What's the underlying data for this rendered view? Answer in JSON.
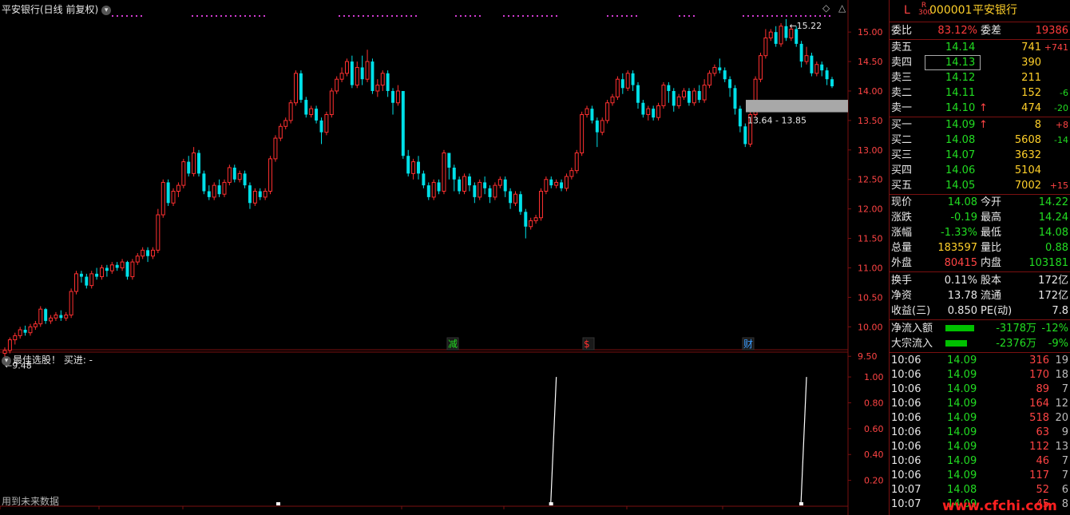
{
  "main_chart": {
    "title": "平安银行(日线 前复权)",
    "high_label": "15.22",
    "low_label": "9.48",
    "range_label": "13.64 - 13.85",
    "y_ticks": [
      "15.00",
      "14.50",
      "14.00",
      "13.50",
      "13.00",
      "12.50",
      "12.00",
      "11.50",
      "11.00",
      "10.50",
      "10.00",
      "9.50"
    ],
    "markers": [
      {
        "text": "减",
        "color": "#22dd22"
      },
      {
        "text": "$",
        "color": "#ff3030"
      },
      {
        "text": "财",
        "color": "#3a9cff"
      }
    ],
    "colors": {
      "up": "#ff3030",
      "down": "#00e0e8",
      "dots": "#d23cd2",
      "grid_frame": "#7a1010"
    }
  },
  "sub_chart": {
    "title": "最佳选股！ 买进: -",
    "y_ticks": [
      "1.00",
      "0.80",
      "0.60",
      "0.40",
      "0.20"
    ],
    "note": "用到未来数据"
  },
  "chart_data": {
    "type": "candlestick",
    "title": "平安银行(日线 前复权)",
    "ylim": [
      9.3,
      15.3
    ],
    "annotations": {
      "high": 15.22,
      "low": 9.48,
      "range": "13.64 - 13.85"
    },
    "candles": [
      [
        9.55,
        9.6,
        9.48,
        9.65
      ],
      [
        9.6,
        9.78,
        9.55,
        9.82
      ],
      [
        9.78,
        9.85,
        9.7,
        9.9
      ],
      [
        9.85,
        9.95,
        9.8,
        10.0
      ],
      [
        9.95,
        9.9,
        9.85,
        10.02
      ],
      [
        9.9,
        10.0,
        9.85,
        10.05
      ],
      [
        10.0,
        10.05,
        9.95,
        10.1
      ],
      [
        10.05,
        10.3,
        10.0,
        10.35
      ],
      [
        10.3,
        10.1,
        10.05,
        10.32
      ],
      [
        10.1,
        10.15,
        10.05,
        10.2
      ],
      [
        10.15,
        10.2,
        10.1,
        10.25
      ],
      [
        10.2,
        10.15,
        10.1,
        10.28
      ],
      [
        10.15,
        10.2,
        10.1,
        10.25
      ],
      [
        10.2,
        10.6,
        10.15,
        10.65
      ],
      [
        10.6,
        10.9,
        10.55,
        10.95
      ],
      [
        10.9,
        10.85,
        10.75,
        10.95
      ],
      [
        10.85,
        10.7,
        10.65,
        10.9
      ],
      [
        10.7,
        10.9,
        10.65,
        10.95
      ],
      [
        10.9,
        10.85,
        10.8,
        11.0
      ],
      [
        10.85,
        11.0,
        10.8,
        11.05
      ],
      [
        11.0,
        10.95,
        10.85,
        11.05
      ],
      [
        10.95,
        11.05,
        10.9,
        11.1
      ],
      [
        11.05,
        11.0,
        10.95,
        11.1
      ],
      [
        11.0,
        11.1,
        10.95,
        11.15
      ],
      [
        11.1,
        10.85,
        10.8,
        11.12
      ],
      [
        10.85,
        11.1,
        10.8,
        11.15
      ],
      [
        11.1,
        11.2,
        11.05,
        11.25
      ],
      [
        11.2,
        11.3,
        11.15,
        11.35
      ],
      [
        11.3,
        11.2,
        11.1,
        11.35
      ],
      [
        11.2,
        11.3,
        11.15,
        11.35
      ],
      [
        11.3,
        11.9,
        11.25,
        12.0
      ],
      [
        11.9,
        12.45,
        11.85,
        12.5
      ],
      [
        12.45,
        12.1,
        12.05,
        12.5
      ],
      [
        12.1,
        12.3,
        12.05,
        12.35
      ],
      [
        12.3,
        12.4,
        12.2,
        12.45
      ],
      [
        12.4,
        12.8,
        12.35,
        12.85
      ],
      [
        12.8,
        12.6,
        12.55,
        12.9
      ],
      [
        12.6,
        12.95,
        12.55,
        13.05
      ],
      [
        12.95,
        12.6,
        12.55,
        13.0
      ],
      [
        12.6,
        12.3,
        12.25,
        12.65
      ],
      [
        12.3,
        12.2,
        12.15,
        12.4
      ],
      [
        12.2,
        12.4,
        12.15,
        12.45
      ],
      [
        12.4,
        12.25,
        12.2,
        12.5
      ],
      [
        12.25,
        12.45,
        12.2,
        12.5
      ],
      [
        12.45,
        12.7,
        12.4,
        12.75
      ],
      [
        12.7,
        12.5,
        12.45,
        12.75
      ],
      [
        12.5,
        12.6,
        12.45,
        12.65
      ],
      [
        12.6,
        12.4,
        12.35,
        12.65
      ],
      [
        12.4,
        12.1,
        12.0,
        12.45
      ],
      [
        12.1,
        12.3,
        12.05,
        12.35
      ],
      [
        12.3,
        12.2,
        12.15,
        12.35
      ],
      [
        12.2,
        12.3,
        12.15,
        12.35
      ],
      [
        12.3,
        12.85,
        12.25,
        12.9
      ],
      [
        12.85,
        13.2,
        12.8,
        13.25
      ],
      [
        13.2,
        13.4,
        13.15,
        13.45
      ],
      [
        13.4,
        13.5,
        13.35,
        13.55
      ],
      [
        13.5,
        13.8,
        13.45,
        13.85
      ],
      [
        13.8,
        14.3,
        13.75,
        14.35
      ],
      [
        14.3,
        13.85,
        13.8,
        14.35
      ],
      [
        13.85,
        13.6,
        13.55,
        13.9
      ],
      [
        13.6,
        13.7,
        13.55,
        13.75
      ],
      [
        13.7,
        13.5,
        13.45,
        13.75
      ],
      [
        13.5,
        13.3,
        13.1,
        13.55
      ],
      [
        13.3,
        13.6,
        13.25,
        13.65
      ],
      [
        13.6,
        14.0,
        13.55,
        14.05
      ],
      [
        14.0,
        14.2,
        13.95,
        14.25
      ],
      [
        14.2,
        14.3,
        14.15,
        14.4
      ],
      [
        14.3,
        14.5,
        14.25,
        14.55
      ],
      [
        14.5,
        14.1,
        14.05,
        14.6
      ],
      [
        14.1,
        14.4,
        14.05,
        14.5
      ],
      [
        14.4,
        14.2,
        14.1,
        14.6
      ],
      [
        14.2,
        14.5,
        14.15,
        14.7
      ],
      [
        14.5,
        14.0,
        13.95,
        14.55
      ],
      [
        14.0,
        14.1,
        13.9,
        14.2
      ],
      [
        14.1,
        14.3,
        14.0,
        14.35
      ],
      [
        14.3,
        14.0,
        13.9,
        14.35
      ],
      [
        14.0,
        13.8,
        13.6,
        14.05
      ],
      [
        13.8,
        14.0,
        13.75,
        14.1
      ],
      [
        14.0,
        12.9,
        12.85,
        14.0
      ],
      [
        12.9,
        12.6,
        12.55,
        13.0
      ],
      [
        12.6,
        12.8,
        12.5,
        12.85
      ],
      [
        12.8,
        12.6,
        12.5,
        12.9
      ],
      [
        12.6,
        12.4,
        12.35,
        12.65
      ],
      [
        12.4,
        12.2,
        12.15,
        12.45
      ],
      [
        12.2,
        12.45,
        12.15,
        12.5
      ],
      [
        12.45,
        12.3,
        12.25,
        12.5
      ],
      [
        12.3,
        12.95,
        12.25,
        13.0
      ],
      [
        12.95,
        12.7,
        12.5,
        12.95
      ],
      [
        12.7,
        12.5,
        12.3,
        12.75
      ],
      [
        12.5,
        12.3,
        12.25,
        12.55
      ],
      [
        12.3,
        12.55,
        12.25,
        12.6
      ],
      [
        12.55,
        12.4,
        12.3,
        12.6
      ],
      [
        12.4,
        12.2,
        12.1,
        12.45
      ],
      [
        12.2,
        12.45,
        12.15,
        12.5
      ],
      [
        12.45,
        12.35,
        12.25,
        12.55
      ],
      [
        12.35,
        12.2,
        12.1,
        12.4
      ],
      [
        12.2,
        12.4,
        12.15,
        12.45
      ],
      [
        12.4,
        12.5,
        12.35,
        12.55
      ],
      [
        12.5,
        12.3,
        12.2,
        12.55
      ],
      [
        12.3,
        12.1,
        12.0,
        12.35
      ],
      [
        12.1,
        12.25,
        12.05,
        12.3
      ],
      [
        12.25,
        11.95,
        11.9,
        12.3
      ],
      [
        11.95,
        11.7,
        11.5,
        12.0
      ],
      [
        11.7,
        11.8,
        11.65,
        11.85
      ],
      [
        11.8,
        11.85,
        11.75,
        11.9
      ],
      [
        11.85,
        12.3,
        11.8,
        12.35
      ],
      [
        12.3,
        12.5,
        12.25,
        12.55
      ],
      [
        12.5,
        12.4,
        12.35,
        12.55
      ],
      [
        12.4,
        12.45,
        12.35,
        12.5
      ],
      [
        12.45,
        12.35,
        12.3,
        12.5
      ],
      [
        12.35,
        12.55,
        12.3,
        12.6
      ],
      [
        12.55,
        12.65,
        12.5,
        12.7
      ],
      [
        12.65,
        12.95,
        12.6,
        13.0
      ],
      [
        12.95,
        13.6,
        12.9,
        13.65
      ],
      [
        13.6,
        13.7,
        13.55,
        13.75
      ],
      [
        13.7,
        13.5,
        13.45,
        13.75
      ],
      [
        13.5,
        13.3,
        13.05,
        13.55
      ],
      [
        13.3,
        13.5,
        13.25,
        13.55
      ],
      [
        13.5,
        13.8,
        13.45,
        13.85
      ],
      [
        13.8,
        13.9,
        13.75,
        13.95
      ],
      [
        13.9,
        14.2,
        13.85,
        14.25
      ],
      [
        14.2,
        14.05,
        13.95,
        14.3
      ],
      [
        14.05,
        14.3,
        14.0,
        14.35
      ],
      [
        14.3,
        14.1,
        14.0,
        14.35
      ],
      [
        14.1,
        13.8,
        13.7,
        14.15
      ],
      [
        13.8,
        13.6,
        13.55,
        13.85
      ],
      [
        13.6,
        13.7,
        13.5,
        13.75
      ],
      [
        13.7,
        13.55,
        13.5,
        13.75
      ],
      [
        13.55,
        13.75,
        13.5,
        13.8
      ],
      [
        13.75,
        14.1,
        13.7,
        14.15
      ],
      [
        14.1,
        14.0,
        13.8,
        14.15
      ],
      [
        14.0,
        13.75,
        13.65,
        14.05
      ],
      [
        13.75,
        13.9,
        13.7,
        13.95
      ],
      [
        13.9,
        14.0,
        13.85,
        14.05
      ],
      [
        14.0,
        13.8,
        13.75,
        14.05
      ],
      [
        13.8,
        14.0,
        13.75,
        14.05
      ],
      [
        14.0,
        13.85,
        13.8,
        14.1
      ],
      [
        13.85,
        14.1,
        13.8,
        14.2
      ],
      [
        14.1,
        14.3,
        14.05,
        14.35
      ],
      [
        14.3,
        14.4,
        14.25,
        14.45
      ],
      [
        14.4,
        14.35,
        14.3,
        14.55
      ],
      [
        14.35,
        14.2,
        14.15,
        14.4
      ],
      [
        14.2,
        14.05,
        13.9,
        14.25
      ],
      [
        14.05,
        13.7,
        13.6,
        14.1
      ],
      [
        13.7,
        13.4,
        13.3,
        13.75
      ],
      [
        13.4,
        13.1,
        13.05,
        13.45
      ],
      [
        13.1,
        13.6,
        13.05,
        13.65
      ],
      [
        13.6,
        14.2,
        13.55,
        14.25
      ],
      [
        14.2,
        14.6,
        14.15,
        14.65
      ],
      [
        14.6,
        14.9,
        14.55,
        15.05
      ],
      [
        14.9,
        15.0,
        14.85,
        15.05
      ],
      [
        15.0,
        14.8,
        14.75,
        15.1
      ],
      [
        14.8,
        15.1,
        14.75,
        15.15
      ],
      [
        15.1,
        14.9,
        14.85,
        15.22
      ],
      [
        14.9,
        15.05,
        14.85,
        15.1
      ],
      [
        15.05,
        14.8,
        14.75,
        15.1
      ],
      [
        14.8,
        14.5,
        14.4,
        14.85
      ],
      [
        14.5,
        14.6,
        14.45,
        14.75
      ],
      [
        14.6,
        14.3,
        14.25,
        14.65
      ],
      [
        14.3,
        14.45,
        14.25,
        14.5
      ],
      [
        14.45,
        14.35,
        14.25,
        14.5
      ],
      [
        14.35,
        14.2,
        14.1,
        14.4
      ],
      [
        14.2,
        14.08,
        14.05,
        14.24
      ]
    ],
    "subplot": {
      "ylim": [
        0,
        1.05
      ],
      "signals": [
        {
          "bar": 108,
          "value": 1.0
        },
        {
          "bar": 157,
          "value": 1.0
        }
      ]
    }
  },
  "quote": {
    "header": {
      "flag": "L",
      "badge_top": "R",
      "badge_bottom": "300",
      "code": "000001",
      "name": "平安银行"
    },
    "weibi": {
      "label": "委比",
      "value": "83.12%",
      "label2": "委差",
      "value2": "19386"
    },
    "asks": [
      {
        "label": "卖五",
        "price": "14.14",
        "vol": "741",
        "chg": "+741",
        "chg_color": "#ff4444"
      },
      {
        "label": "卖四",
        "price": "14.13",
        "vol": "390",
        "chg": "",
        "chg_color": "#ff4444"
      },
      {
        "label": "卖三",
        "price": "14.12",
        "vol": "211",
        "chg": "",
        "chg_color": "#ff4444"
      },
      {
        "label": "卖二",
        "price": "14.11",
        "vol": "152",
        "chg": "-6",
        "chg_color": "#22dd22"
      },
      {
        "label": "卖一",
        "price": "14.10",
        "vol": "474",
        "chg": "-20",
        "chg_color": "#22dd22",
        "arrow": "↑"
      }
    ],
    "bids": [
      {
        "label": "买一",
        "price": "14.09",
        "vol": "8",
        "chg": "+8",
        "chg_color": "#ff4444",
        "arrow": "↑"
      },
      {
        "label": "买二",
        "price": "14.08",
        "vol": "5608",
        "chg": "-14",
        "chg_color": "#22dd22"
      },
      {
        "label": "买三",
        "price": "14.07",
        "vol": "3632",
        "chg": "",
        "chg_color": "#ff4444"
      },
      {
        "label": "买四",
        "price": "14.06",
        "vol": "5104",
        "chg": "",
        "chg_color": "#ff4444"
      },
      {
        "label": "买五",
        "price": "14.05",
        "vol": "7002",
        "chg": "+15",
        "chg_color": "#ff4444"
      }
    ],
    "stats": [
      {
        "l1": "现价",
        "v1": "14.08",
        "c1": "#22dd22",
        "l2": "今开",
        "v2": "14.22",
        "c2": "#22dd22"
      },
      {
        "l1": "涨跌",
        "v1": "-0.19",
        "c1": "#22dd22",
        "l2": "最高",
        "v2": "14.24",
        "c2": "#22dd22"
      },
      {
        "l1": "涨幅",
        "v1": "-1.33%",
        "c1": "#22dd22",
        "l2": "最低",
        "v2": "14.08",
        "c2": "#22dd22"
      },
      {
        "l1": "总量",
        "v1": "183597",
        "c1": "#ffd02a",
        "l2": "量比",
        "v2": "0.88",
        "c2": "#22dd22"
      },
      {
        "l1": "外盘",
        "v1": "80415",
        "c1": "#ff4444",
        "l2": "内盘",
        "v2": "103181",
        "c2": "#22dd22"
      }
    ],
    "fundamentals": [
      {
        "l1": "换手",
        "v1": "0.11%",
        "l2": "股本",
        "v2": "172亿"
      },
      {
        "l1": "净资",
        "v1": "13.78",
        "l2": "流通",
        "v2": "172亿"
      },
      {
        "l1": "收益(三)",
        "v1": "0.850",
        "l2": "PE(动)",
        "v2": "7.8"
      }
    ],
    "flows": [
      {
        "label": "净流入额",
        "amount": "-3178万",
        "pct": "-12%",
        "bar_fraction": 0.75
      },
      {
        "label": "大宗流入",
        "amount": "-2376万",
        "pct": "-9%",
        "bar_fraction": 0.56
      }
    ],
    "ticks": [
      {
        "time": "10:06",
        "price": "14.09",
        "vol": "316",
        "cnt": "19"
      },
      {
        "time": "10:06",
        "price": "14.09",
        "vol": "170",
        "cnt": "18"
      },
      {
        "time": "10:06",
        "price": "14.09",
        "vol": "89",
        "cnt": "7"
      },
      {
        "time": "10:06",
        "price": "14.09",
        "vol": "164",
        "cnt": "12"
      },
      {
        "time": "10:06",
        "price": "14.09",
        "vol": "518",
        "cnt": "20"
      },
      {
        "time": "10:06",
        "price": "14.09",
        "vol": "63",
        "cnt": "9"
      },
      {
        "time": "10:06",
        "price": "14.09",
        "vol": "112",
        "cnt": "13"
      },
      {
        "time": "10:06",
        "price": "14.09",
        "vol": "46",
        "cnt": "7"
      },
      {
        "time": "10:06",
        "price": "14.09",
        "vol": "117",
        "cnt": "7"
      },
      {
        "time": "10:07",
        "price": "14.08",
        "vol": "52",
        "cnt": "6"
      },
      {
        "time": "10:07",
        "price": "14.09",
        "vol": "45",
        "cnt": "8"
      }
    ],
    "watermark": "www.cfchi.com"
  }
}
